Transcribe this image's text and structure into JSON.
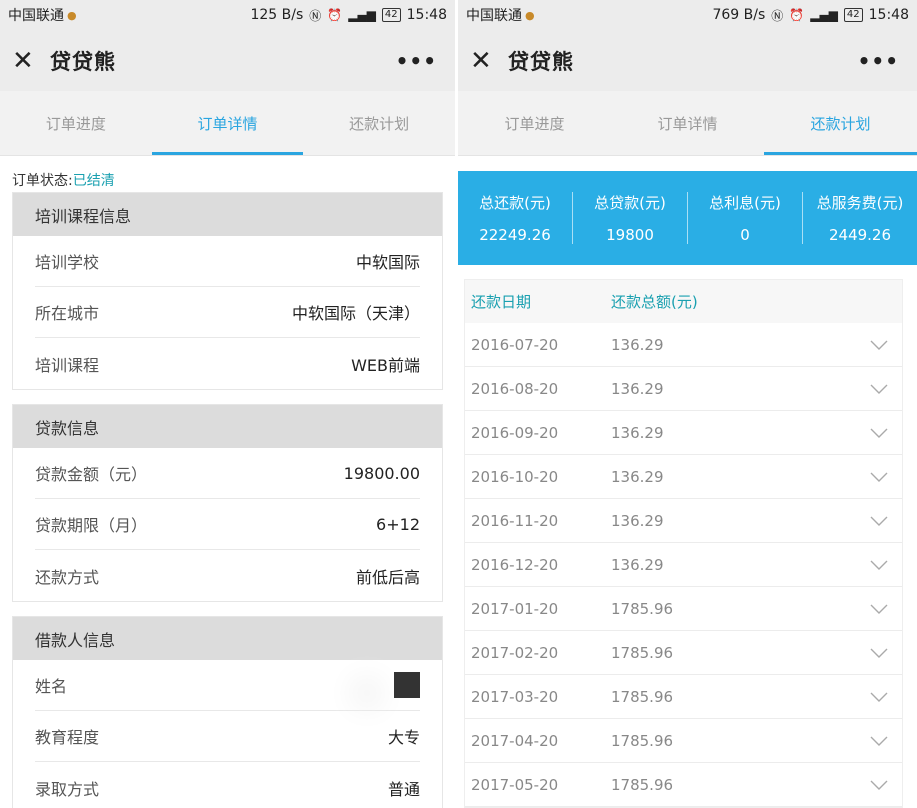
{
  "left": {
    "status": {
      "carrier": "中国联通",
      "speed": "125 B/s",
      "battery": "42",
      "time": "15:48"
    },
    "title": "贷贷熊",
    "tabs": [
      "订单进度",
      "订单详情",
      "还款计划"
    ],
    "active_tab": 1,
    "order_status_label": "订单状态:",
    "order_status_value": "已结清",
    "sections": [
      {
        "title": "培训课程信息",
        "rows": [
          {
            "label": "培训学校",
            "value": "中软国际"
          },
          {
            "label": "所在城市",
            "value": "中软国际（天津）"
          },
          {
            "label": "培训课程",
            "value": "WEB前端"
          }
        ]
      },
      {
        "title": "贷款信息",
        "rows": [
          {
            "label": "贷款金额（元）",
            "value": "19800.00"
          },
          {
            "label": "贷款期限（月）",
            "value": "6+12"
          },
          {
            "label": "还款方式",
            "value": "前低后高"
          }
        ]
      },
      {
        "title": "借款人信息",
        "rows": [
          {
            "label": "姓名",
            "value": ""
          },
          {
            "label": "教育程度",
            "value": "大专"
          },
          {
            "label": "录取方式",
            "value": "普通"
          }
        ]
      }
    ]
  },
  "right": {
    "status": {
      "carrier": "中国联通",
      "speed": "769 B/s",
      "battery": "42",
      "time": "15:48"
    },
    "title": "贷贷熊",
    "tabs": [
      "订单进度",
      "订单详情",
      "还款计划"
    ],
    "active_tab": 2,
    "summary": [
      {
        "label": "总还款(元)",
        "value": "22249.26"
      },
      {
        "label": "总贷款(元)",
        "value": "19800"
      },
      {
        "label": "总利息(元)",
        "value": "0"
      },
      {
        "label": "总服务费(元)",
        "value": "2449.26"
      }
    ],
    "plan_headers": [
      "还款日期",
      "还款总额(元)"
    ],
    "plan_rows": [
      {
        "date": "2016-07-20",
        "amount": "136.29"
      },
      {
        "date": "2016-08-20",
        "amount": "136.29"
      },
      {
        "date": "2016-09-20",
        "amount": "136.29"
      },
      {
        "date": "2016-10-20",
        "amount": "136.29"
      },
      {
        "date": "2016-11-20",
        "amount": "136.29"
      },
      {
        "date": "2016-12-20",
        "amount": "136.29"
      },
      {
        "date": "2017-01-20",
        "amount": "1785.96"
      },
      {
        "date": "2017-02-20",
        "amount": "1785.96"
      },
      {
        "date": "2017-03-20",
        "amount": "1785.96"
      },
      {
        "date": "2017-04-20",
        "amount": "1785.96"
      },
      {
        "date": "2017-05-20",
        "amount": "1785.96"
      }
    ]
  },
  "icons": {
    "close": "close-icon",
    "more": "more-icon",
    "chevron": "chevron-down-icon"
  },
  "colors": {
    "accent": "#2aa5e0",
    "status_green": "#1aa0b0",
    "summary_bg": "#2aaee5"
  }
}
